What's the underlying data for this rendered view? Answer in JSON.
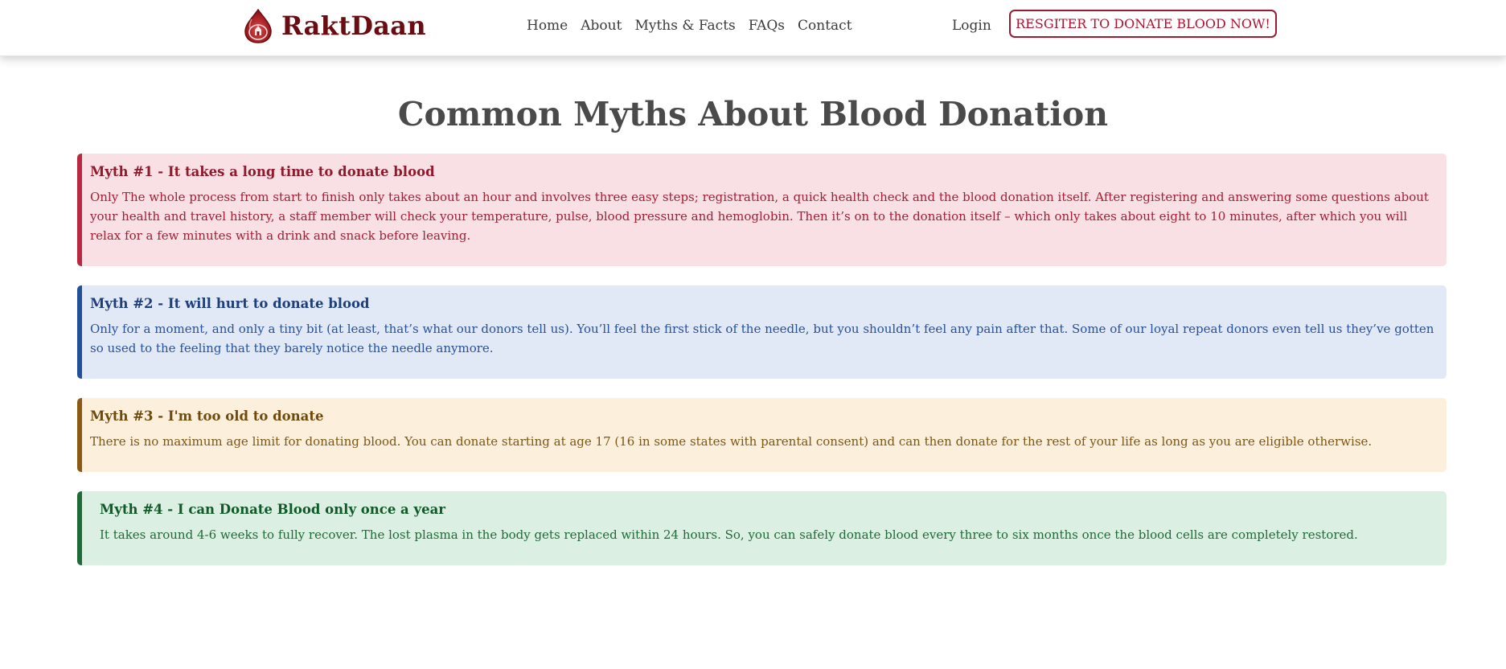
{
  "brand": {
    "name": "RaktDaan",
    "logo_icon": "blood-drop-logo-icon"
  },
  "nav": {
    "links": [
      "Home",
      "About",
      "Myths & Facts",
      "FAQs",
      "Contact"
    ],
    "login": "Login",
    "register": "RESGITER TO DONATE BLOOD NOW!"
  },
  "main": {
    "title": "Common Myths About Blood Donation",
    "myths": [
      {
        "heading": "Myth #1 - It takes a long time to donate blood",
        "body": "Only The whole process from start to finish only takes about an hour and involves three easy steps; registration, a quick health check and the blood donation itself. After registering and answering some questions about your health and travel history, a staff member will check your temperature, pulse, blood pressure and hemoglobin. Then it’s on to the donation itself – which only takes about eight to 10 minutes, after which you will relax for a few minutes with a drink and snack before leaving.",
        "color": "#b8283f"
      },
      {
        "heading": "Myth #2 - It will hurt to donate blood",
        "body": "Only for a moment, and only a tiny bit (at least, that’s what our donors tell us). You’ll feel the first stick of the needle, but you shouldn’t feel any pain after that. Some of our loyal repeat donors even tell us they’ve gotten so used to the feeling that they barely notice the needle anymore.",
        "color": "#21509b"
      },
      {
        "heading": "Myth #3 - I'm too old to donate",
        "body": "There is no maximum age limit for donating blood. You can donate starting at age 17 (16 in some states with parental consent) and can then donate for the rest of your life as long as you are eligible otherwise.",
        "color": "#8a5a12"
      },
      {
        "heading": "Myth #4 - I can Donate Blood only once a year",
        "body": "It takes around 4-6 weeks to fully recover. The lost plasma in the body gets replaced within 24 hours. So, you can safely donate blood every three to six months once the blood cells are completely restored.",
        "color": "#1e6b37"
      }
    ]
  }
}
